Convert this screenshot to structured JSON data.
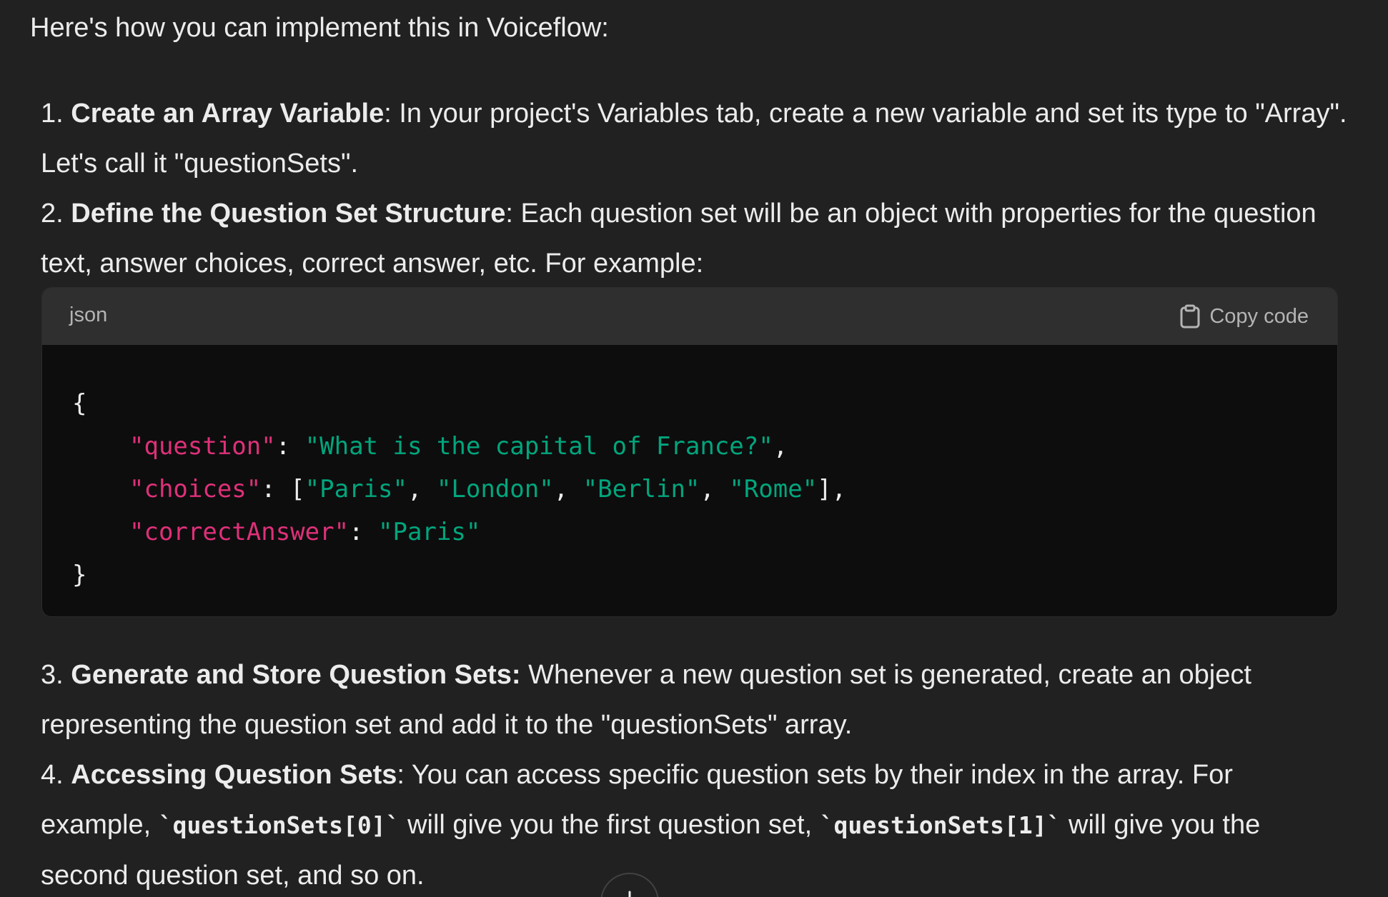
{
  "intro": "Here's how you can implement this in Voiceflow:",
  "steps": [
    {
      "number": "1.",
      "title": "Create an Array Variable",
      "sep": ":",
      "text": " In your project's Variables tab, create a new variable and set its type to \"Array\". Let's call it \"questionSets\"."
    },
    {
      "number": "2.",
      "title": "Define the Question Set Structure",
      "sep": ":",
      "text": " Each question set will be an object with properties for the question text, answer choices, correct answer, etc. For example:"
    },
    {
      "number": "3.",
      "title": "Generate and Store Question Sets:",
      "sep": "",
      "text": " Whenever a new question set is generated, create an object representing the question set and add it to the \"questionSets\" array."
    },
    {
      "number": "4.",
      "title": "Accessing Question Sets",
      "sep": ":",
      "text_a": " You can access specific question sets by their index in the array. For example, ",
      "code_a": "`questionSets[0]`",
      "text_b": " will give you the first question set, ",
      "code_b": "`questionSets[1]`",
      "text_c": " will give you the second question set, and so on."
    }
  ],
  "code_block": {
    "language": "json",
    "copy_label": "Copy code",
    "open_brace": "{",
    "close_brace": "}",
    "lines": [
      {
        "key": "\"question\"",
        "colon": ": ",
        "value": "\"What is the capital of France?\"",
        "tail": ","
      },
      {
        "key": "\"choices\"",
        "colon": ": [",
        "v1": "\"Paris\"",
        "v2": "\"London\"",
        "v3": "\"Berlin\"",
        "v4": "\"Rome\"",
        "comma": ", ",
        "tail": "],"
      },
      {
        "key": "\"correctAnswer\"",
        "colon": ": ",
        "value": "\"Paris\"",
        "tail": ""
      }
    ]
  },
  "icons": {
    "copy": "clipboard-icon",
    "scroll": "arrow-down-icon"
  },
  "colors": {
    "background": "#212121",
    "code_background": "#0d0d0d",
    "code_header": "#2f2f2f",
    "json_key": "#df3079",
    "json_string": "#00a67d"
  }
}
